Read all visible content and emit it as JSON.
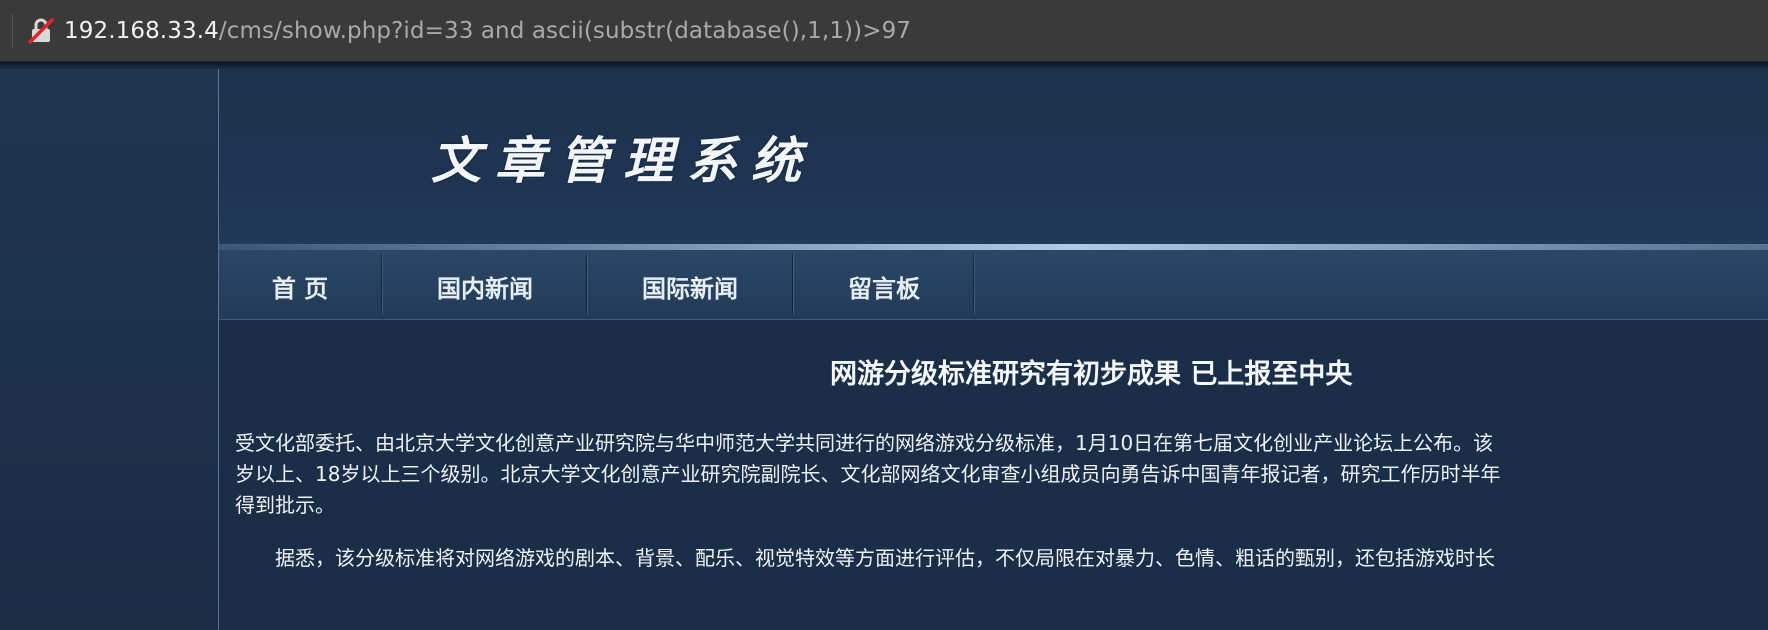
{
  "browser": {
    "url_host": "192.168.33.4",
    "url_path": "/cms/show.php?id=33 and ascii(substr(database(),1,1))>97"
  },
  "site": {
    "logo_text": "文章管理系统"
  },
  "nav": {
    "items": [
      {
        "label": "首 页"
      },
      {
        "label": "国内新闻"
      },
      {
        "label": "国际新闻"
      },
      {
        "label": "留言板"
      }
    ]
  },
  "article": {
    "title": "网游分级标准研究有初步成果 已上报至中央",
    "lines": [
      "受文化部委托、由北京大学文化创意产业研究院与华中师范大学共同进行的网络游戏分级标准，1月10日在第七届文化创业产业论坛上公布。该",
      "岁以上、18岁以上三个级别。北京大学文化创意产业研究院副院长、文化部网络文化审查小组成员向勇告诉中国青年报记者，研究工作历时半年",
      "得到批示。",
      "　　据悉，该分级标准将对网络游戏的剧本、背景、配乐、视觉特效等方面进行评估，不仅局限在对暴力、色情、粗话的甄别，还包括游戏时长"
    ]
  },
  "colors": {
    "page_bg": "#1b2e47",
    "urlbar_bg": "#3a3a3a",
    "nav_text": "#e6edf5"
  }
}
